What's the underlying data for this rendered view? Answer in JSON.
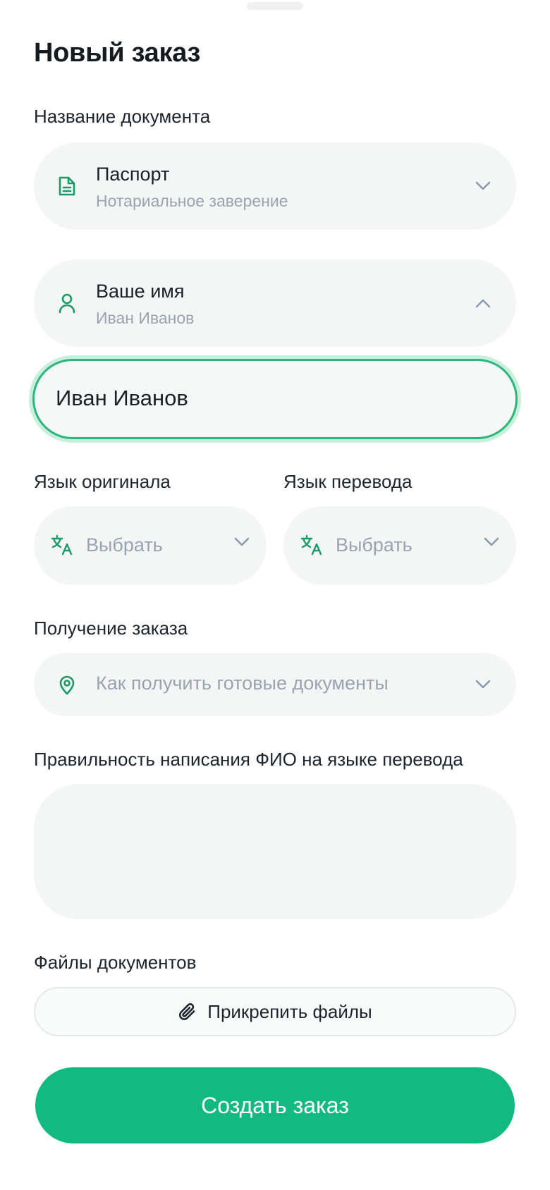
{
  "colors": {
    "accent": "#12b981",
    "icon": "#1a9a66",
    "field_bg": "#f4f6f6",
    "muted_text": "#9aa3b0"
  },
  "title": "Новый заказ",
  "document": {
    "label": "Название документа",
    "value": "Паспорт",
    "subtitle": "Нотариальное заверение",
    "icon": "document-icon"
  },
  "name": {
    "label": "Ваше имя",
    "value": "Иван Иванов",
    "icon": "person-icon",
    "input_value": "Иван Иванов"
  },
  "languages": {
    "original_label": "Язык оригинала",
    "target_label": "Язык перевода",
    "original_placeholder": "Выбрать",
    "target_placeholder": "Выбрать",
    "icon": "translate-icon"
  },
  "delivery": {
    "label": "Получение заказа",
    "placeholder": "Как получить готовые документы",
    "icon": "location-pin-icon"
  },
  "spelling": {
    "label": "Правильность написания ФИО на языке перевода",
    "value": ""
  },
  "files": {
    "label": "Файлы документов",
    "button": "Прикрепить файлы",
    "icon": "paperclip-icon"
  },
  "submit": "Создать заказ"
}
